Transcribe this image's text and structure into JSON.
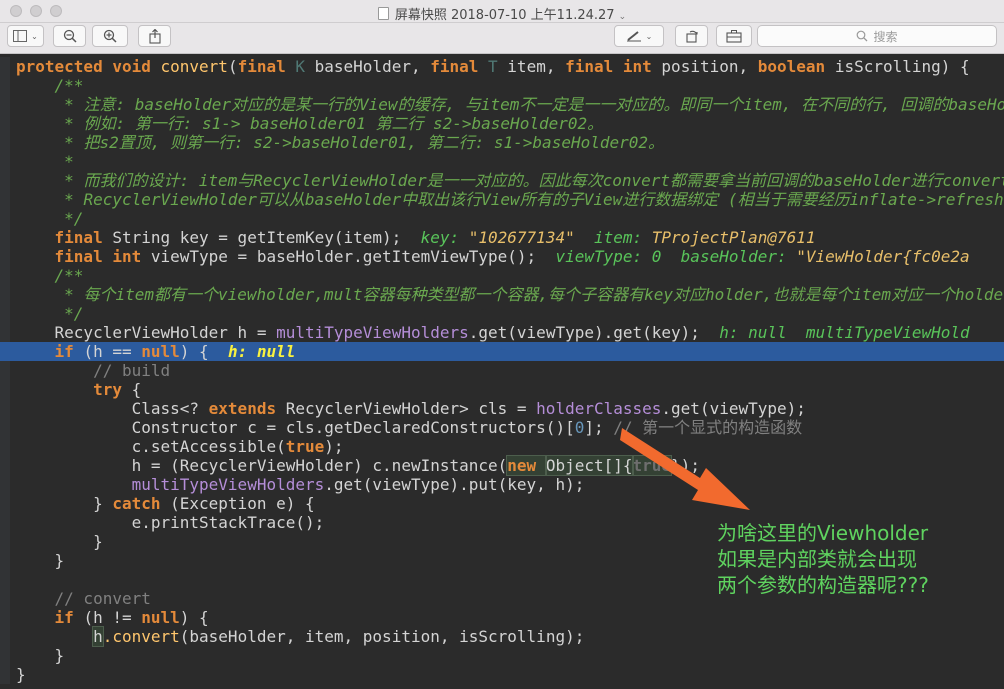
{
  "window": {
    "title": "屏幕快照 2018-07-10 上午11.24.27",
    "title_chevron": "⌄"
  },
  "toolbar": {
    "search_placeholder": "搜索",
    "sidebar_chevron": "⌄",
    "markup_chevron": "⌄"
  },
  "code_lines": [
    {
      "indent": "",
      "gutter": "",
      "parts": [
        [
          "k",
          "protected "
        ],
        [
          "k",
          "void "
        ],
        [
          "f",
          "convert"
        ],
        [
          "",
          "("
        ],
        [
          "k",
          "final "
        ],
        [
          "tp",
          "K "
        ],
        [
          "",
          "baseHolder, "
        ],
        [
          "k",
          "final "
        ],
        [
          "tp",
          "T "
        ],
        [
          "",
          "item, "
        ],
        [
          "k",
          "final "
        ],
        [
          "k",
          "int "
        ],
        [
          "",
          "position, "
        ],
        [
          "k",
          "boolean "
        ],
        [
          "",
          "isScrolling) {"
        ]
      ]
    },
    {
      "indent": "    ",
      "gutter": "",
      "parts": [
        [
          "doc",
          "/**"
        ]
      ]
    },
    {
      "indent": "     ",
      "gutter": "",
      "parts": [
        [
          "doc",
          "* 注意: baseHolder对应的是某一行的View的缓存, 与item不一定是一一对应的。即同一个item, 在不同的行, 回调的baseHolder"
        ]
      ]
    },
    {
      "indent": "     ",
      "gutter": "",
      "parts": [
        [
          "doc",
          "* 例如: 第一行: s1-> baseHolder01 第二行 s2->baseHolder02。"
        ]
      ]
    },
    {
      "indent": "     ",
      "gutter": "",
      "parts": [
        [
          "doc",
          "* 把s2置顶, 则第一行: s2->baseHolder01, 第二行: s1->baseHolder02。"
        ]
      ]
    },
    {
      "indent": "     ",
      "gutter": "",
      "parts": [
        [
          "doc",
          "*"
        ]
      ]
    },
    {
      "indent": "     ",
      "gutter": "",
      "parts": [
        [
          "doc",
          "* 而我们的设计: item与RecyclerViewHolder是一一对应的。因此每次convert都需要拿当前回调的baseHolder进行convert"
        ]
      ]
    },
    {
      "indent": "     ",
      "gutter": "",
      "parts": [
        [
          "doc",
          "* RecyclerViewHolder可以从baseHolder中取出该行View所有的子View进行数据绑定 (相当于需要经历inflate->refresh"
        ]
      ]
    },
    {
      "indent": "     ",
      "gutter": "",
      "parts": [
        [
          "doc",
          "*/"
        ]
      ]
    },
    {
      "indent": "    ",
      "gutter": "",
      "parts": [
        [
          "k",
          "final "
        ],
        [
          "",
          "String key = getItemKey(item);  "
        ],
        [
          "dv",
          "key: "
        ],
        [
          "dvv",
          "\"102677134\"  "
        ],
        [
          "dv",
          "item: "
        ],
        [
          "dvv",
          "TProjectPlan@7611"
        ]
      ]
    },
    {
      "indent": "    ",
      "gutter": "",
      "parts": [
        [
          "k",
          "final "
        ],
        [
          "k",
          "int "
        ],
        [
          "",
          "viewType = baseHolder.getItemViewType();  "
        ],
        [
          "dv",
          "viewType: 0  "
        ],
        [
          "dv",
          "baseHolder: "
        ],
        [
          "dvv",
          "\"ViewHolder{fc0e2a"
        ]
      ]
    },
    {
      "indent": "    ",
      "gutter": "",
      "parts": [
        [
          "doc",
          "/**"
        ]
      ]
    },
    {
      "indent": "     ",
      "gutter": "",
      "parts": [
        [
          "doc",
          "* 每个item都有一个viewholder,mult容器每种类型都一个容器,每个子容器有key对应holder,也就是每个item对应一个holder"
        ]
      ]
    },
    {
      "indent": "     ",
      "gutter": "",
      "parts": [
        [
          "doc",
          "*/"
        ]
      ]
    },
    {
      "indent": "    ",
      "gutter": "",
      "parts": [
        [
          "",
          "RecyclerViewHolder h = "
        ],
        [
          "fld",
          "multiTypeViewHolders"
        ],
        [
          "",
          ".get(viewType).get(key);  "
        ],
        [
          "dv",
          "h: null  "
        ],
        [
          "dv",
          "multiTypeViewHold"
        ]
      ]
    },
    {
      "indent": "    ",
      "gutter": "",
      "highlight": true,
      "parts": [
        [
          "k",
          "if "
        ],
        [
          "",
          "(h == "
        ],
        [
          "k",
          "null"
        ],
        [
          "",
          ") {  "
        ],
        [
          "hv",
          "h: null"
        ]
      ]
    },
    {
      "indent": "        ",
      "gutter": "",
      "parts": [
        [
          "cmt",
          "// build"
        ]
      ]
    },
    {
      "indent": "        ",
      "gutter": "",
      "parts": [
        [
          "k",
          "try "
        ],
        [
          "",
          "{"
        ]
      ]
    },
    {
      "indent": "            ",
      "gutter": "",
      "parts": [
        [
          "",
          "Class<? "
        ],
        [
          "k",
          "extends "
        ],
        [
          "",
          "RecyclerViewHolder> cls = "
        ],
        [
          "fld",
          "holderClasses"
        ],
        [
          "",
          ".get(viewType);"
        ]
      ]
    },
    {
      "indent": "            ",
      "gutter": "",
      "parts": [
        [
          "",
          "Constructor c = cls.getDeclaredConstructors()["
        ],
        [
          "num",
          "0"
        ],
        [
          "",
          "];"
        ],
        [
          "cmt",
          " // 第一个显式的构造函数"
        ]
      ]
    },
    {
      "indent": "            ",
      "gutter": "",
      "parts": [
        [
          "",
          "c.setAccessible("
        ],
        [
          "k",
          "true"
        ],
        [
          "",
          ");"
        ]
      ]
    },
    {
      "indent": "            ",
      "gutter": "",
      "parts": [
        [
          "",
          "h = (RecyclerViewHolder) c.newInstance("
        ],
        [
          "kbox",
          "new "
        ],
        [
          "box",
          "Object[]{"
        ],
        [
          "kdim",
          "true"
        ],
        [
          "",
          "});"
        ]
      ]
    },
    {
      "indent": "            ",
      "gutter": "",
      "parts": [
        [
          "fld",
          "multiTypeViewHolders"
        ],
        [
          "",
          ".get(viewType).put(key, h);"
        ]
      ]
    },
    {
      "indent": "        ",
      "gutter": "",
      "parts": [
        [
          "",
          "} "
        ],
        [
          "k",
          "catch "
        ],
        [
          "",
          "(Exception e) {"
        ]
      ]
    },
    {
      "indent": "            ",
      "gutter": "",
      "parts": [
        [
          "",
          "e.printStackTrace();"
        ]
      ]
    },
    {
      "indent": "        ",
      "gutter": "",
      "parts": [
        [
          "",
          "}"
        ]
      ]
    },
    {
      "indent": "    ",
      "gutter": "",
      "parts": [
        [
          "",
          "}"
        ]
      ]
    },
    {
      "indent": "",
      "gutter": "",
      "parts": [
        [
          "",
          ""
        ]
      ]
    },
    {
      "indent": "    ",
      "gutter": "",
      "parts": [
        [
          "cmt",
          "// convert"
        ]
      ]
    },
    {
      "indent": "    ",
      "gutter": "",
      "parts": [
        [
          "k",
          "if "
        ],
        [
          "",
          "(h != "
        ],
        [
          "k",
          "null"
        ],
        [
          "",
          ") {"
        ]
      ]
    },
    {
      "indent": "        ",
      "gutter": "",
      "parts": [
        [
          "box",
          "h"
        ],
        [
          "f",
          ".convert"
        ],
        [
          "",
          "(baseHolder, item, position, isScrolling);"
        ]
      ]
    },
    {
      "indent": "    ",
      "gutter": "",
      "parts": [
        [
          "",
          "}"
        ]
      ]
    },
    {
      "indent": "",
      "gutter": "",
      "parts": [
        [
          "",
          "}"
        ]
      ]
    }
  ],
  "annotation": {
    "lines": [
      "为啥这里的Viewholder",
      "如果是内部类就会出现",
      "两个参数的构造器呢???"
    ],
    "color": "#5fd35f",
    "arrow_color": "#f26a2e"
  }
}
